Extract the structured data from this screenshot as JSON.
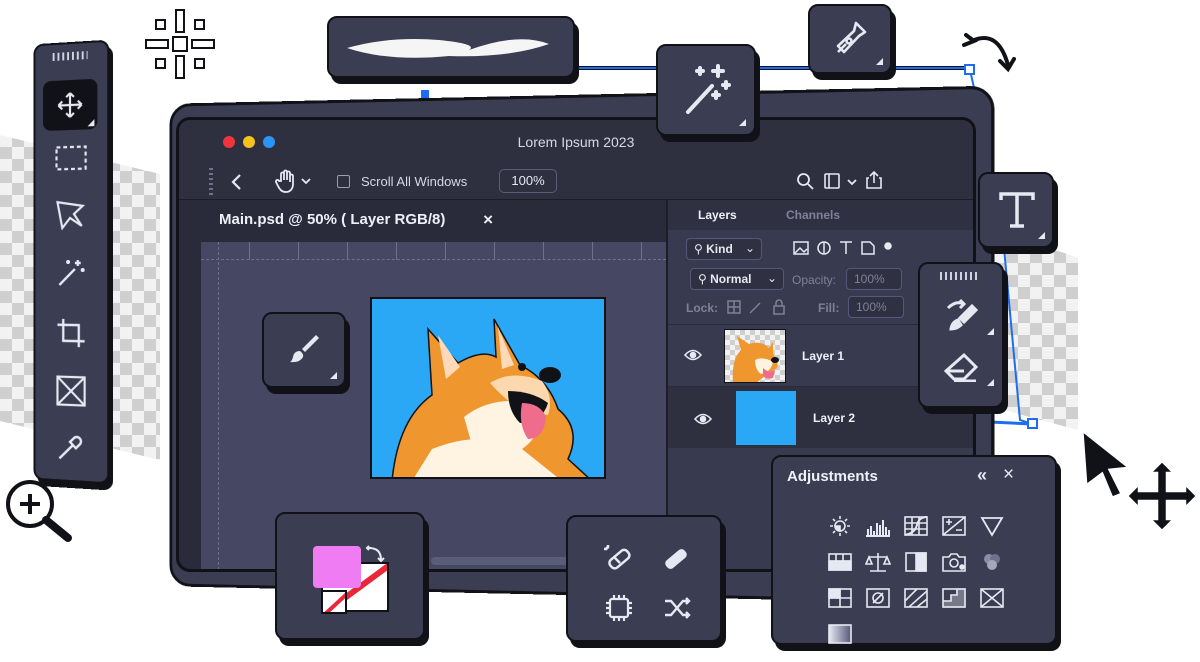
{
  "window": {
    "title": "Lorem Ipsum 2023"
  },
  "toolbar": {
    "scroll_all_label": "Scroll All Windows",
    "zoom_value": "100%"
  },
  "document": {
    "tab_title": "Main.psd @ 50% ( Layer RGB/8)",
    "close_glyph": "×"
  },
  "layers_panel": {
    "tabs": [
      "Layers",
      "Channels"
    ],
    "kind_label": "Kind",
    "blend_mode": "Normal",
    "opacity_label": "Opacity:",
    "opacity_value": "100%",
    "lock_label": "Lock:",
    "fill_label": "Fill:",
    "fill_value": "100%",
    "layers": [
      {
        "name": "Layer 1"
      },
      {
        "name": "Layer 2",
        "color": "#2aa7f5"
      }
    ]
  },
  "adjustments": {
    "title": "Adjustments",
    "collapse_glyph": "«",
    "close_glyph": "×"
  },
  "colors": {
    "panel": "#3b3d52",
    "outline": "#111218",
    "accent_blue": "#1f6cf0",
    "canvas_blue": "#2aa7f5",
    "foreground_swatch": "#f07cf4",
    "red_slash": "#e8283a"
  },
  "tools": [
    "move-icon",
    "marquee-icon",
    "lasso-icon",
    "magic-wand-icon",
    "crop-icon",
    "frame-icon",
    "eyedropper-icon",
    "brush-icon",
    "pen-icon",
    "type-icon",
    "eraser-icon",
    "history-brush-icon",
    "zoom-icon",
    "cursor-icon"
  ]
}
